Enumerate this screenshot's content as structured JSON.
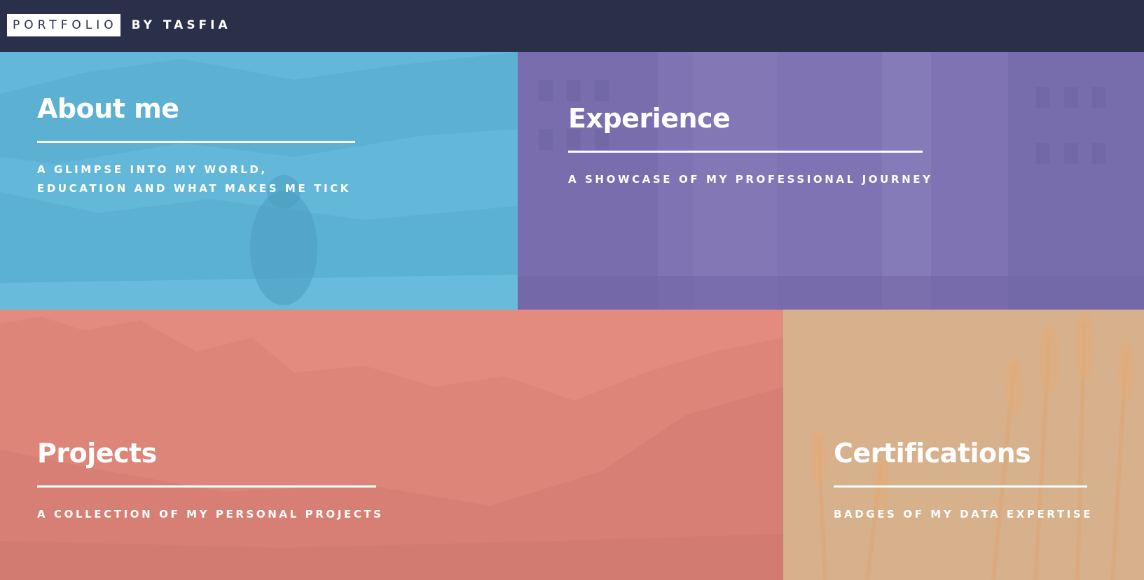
{
  "header": {
    "logo_box": "PORTFOLIO",
    "logo_rest": "BY TASFIA",
    "background_color": "#2a2f4a"
  },
  "tiles": [
    {
      "title": "About me",
      "subtitle": "A GLIMPSE INTO MY WORLD, EDUCATION AND WHAT MAKES ME TICK",
      "color": "#63b8d9"
    },
    {
      "title": "Experience",
      "subtitle": "A SHOWCASE OF MY PROFESSIONAL JOURNEY",
      "color": "#7f73b4"
    },
    {
      "title": "Projects",
      "subtitle": "A COLLECTION OF MY PERSONAL PROJECTS",
      "color": "#e38b7e"
    },
    {
      "title": "Certifications",
      "subtitle": "BADGES OF MY DATA EXPERTISE",
      "color": "#d7b08c"
    }
  ]
}
